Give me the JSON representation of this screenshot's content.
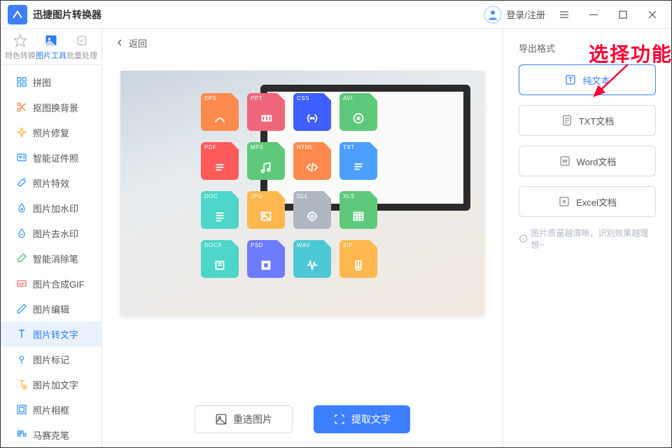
{
  "app": {
    "title": "迅捷图片转换器"
  },
  "titlebar": {
    "login": "登录/注册"
  },
  "modes": [
    {
      "label": "特色转换",
      "active": false
    },
    {
      "label": "图片工具",
      "active": true
    },
    {
      "label": "批量处理",
      "active": false
    }
  ],
  "menu": [
    {
      "icon": "grid",
      "color": "#3d9bff",
      "label": "拼图"
    },
    {
      "icon": "scissors",
      "color": "#ff7b4d",
      "label": "抠图换背景"
    },
    {
      "icon": "sparkle",
      "color": "#ffb84d",
      "label": "照片修复"
    },
    {
      "icon": "idcard",
      "color": "#3d9bff",
      "label": "智能证件照"
    },
    {
      "icon": "magic",
      "color": "#3d9bff",
      "label": "照片特效"
    },
    {
      "icon": "water-add",
      "color": "#3d9bff",
      "label": "图片加水印"
    },
    {
      "icon": "water-remove",
      "color": "#3d9bff",
      "label": "图片去水印"
    },
    {
      "icon": "eraser",
      "color": "#4dc97b",
      "label": "智能消除笔"
    },
    {
      "icon": "gif",
      "color": "#ff6b6b",
      "label": "图片合成GIF"
    },
    {
      "icon": "edit",
      "color": "#3d9bff",
      "label": "图片编辑"
    },
    {
      "icon": "text",
      "color": "#ff7b4d",
      "label": "图片转文字",
      "active": true
    },
    {
      "icon": "marker",
      "color": "#3d9bff",
      "label": "图片标记"
    },
    {
      "icon": "addtext",
      "color": "#ffb84d",
      "label": "图片加文字"
    },
    {
      "icon": "frame",
      "color": "#3d9bff",
      "label": "照片相框"
    },
    {
      "icon": "mosaic",
      "color": "#3d9bff",
      "label": "马赛克笔"
    }
  ],
  "content": {
    "back": "返回",
    "reselect": "重选图片",
    "extract": "提取文字"
  },
  "preview_icons": [
    {
      "fmt": "EPS",
      "color": "#ff8a4d"
    },
    {
      "fmt": "PPT",
      "color": "#f0677b"
    },
    {
      "fmt": "CSS",
      "color": "#3d5fff"
    },
    {
      "fmt": "AVI",
      "color": "#5fc97b"
    },
    {
      "fmt": "PDF",
      "color": "#ff5a5a"
    },
    {
      "fmt": "MP3",
      "color": "#5fc97b"
    },
    {
      "fmt": "HTML",
      "color": "#ff8a4d"
    },
    {
      "fmt": "TXT",
      "color": "#4d9fff"
    },
    {
      "fmt": "DOC",
      "color": "#4dd6c9"
    },
    {
      "fmt": "JPG",
      "color": "#ffb84d"
    },
    {
      "fmt": "DLL",
      "color": "#b0b7c3"
    },
    {
      "fmt": "XLS",
      "color": "#5fc97b"
    },
    {
      "fmt": "DOCX",
      "color": "#4dd6c9"
    },
    {
      "fmt": "PSD",
      "color": "#6d7bff"
    },
    {
      "fmt": "WAV",
      "color": "#4dc9d6"
    },
    {
      "fmt": "ZIP",
      "color": "#ffb84d"
    }
  ],
  "export": {
    "title": "导出格式",
    "annotation": "选择功能",
    "options": [
      {
        "label": "纯文本",
        "icon": "T",
        "selected": true
      },
      {
        "label": "TXT文档",
        "icon": "txt"
      },
      {
        "label": "Word文档",
        "icon": "W"
      },
      {
        "label": "Excel文档",
        "icon": "X"
      }
    ],
    "hint": "图片质量越清晰，识别效果越理想~"
  }
}
